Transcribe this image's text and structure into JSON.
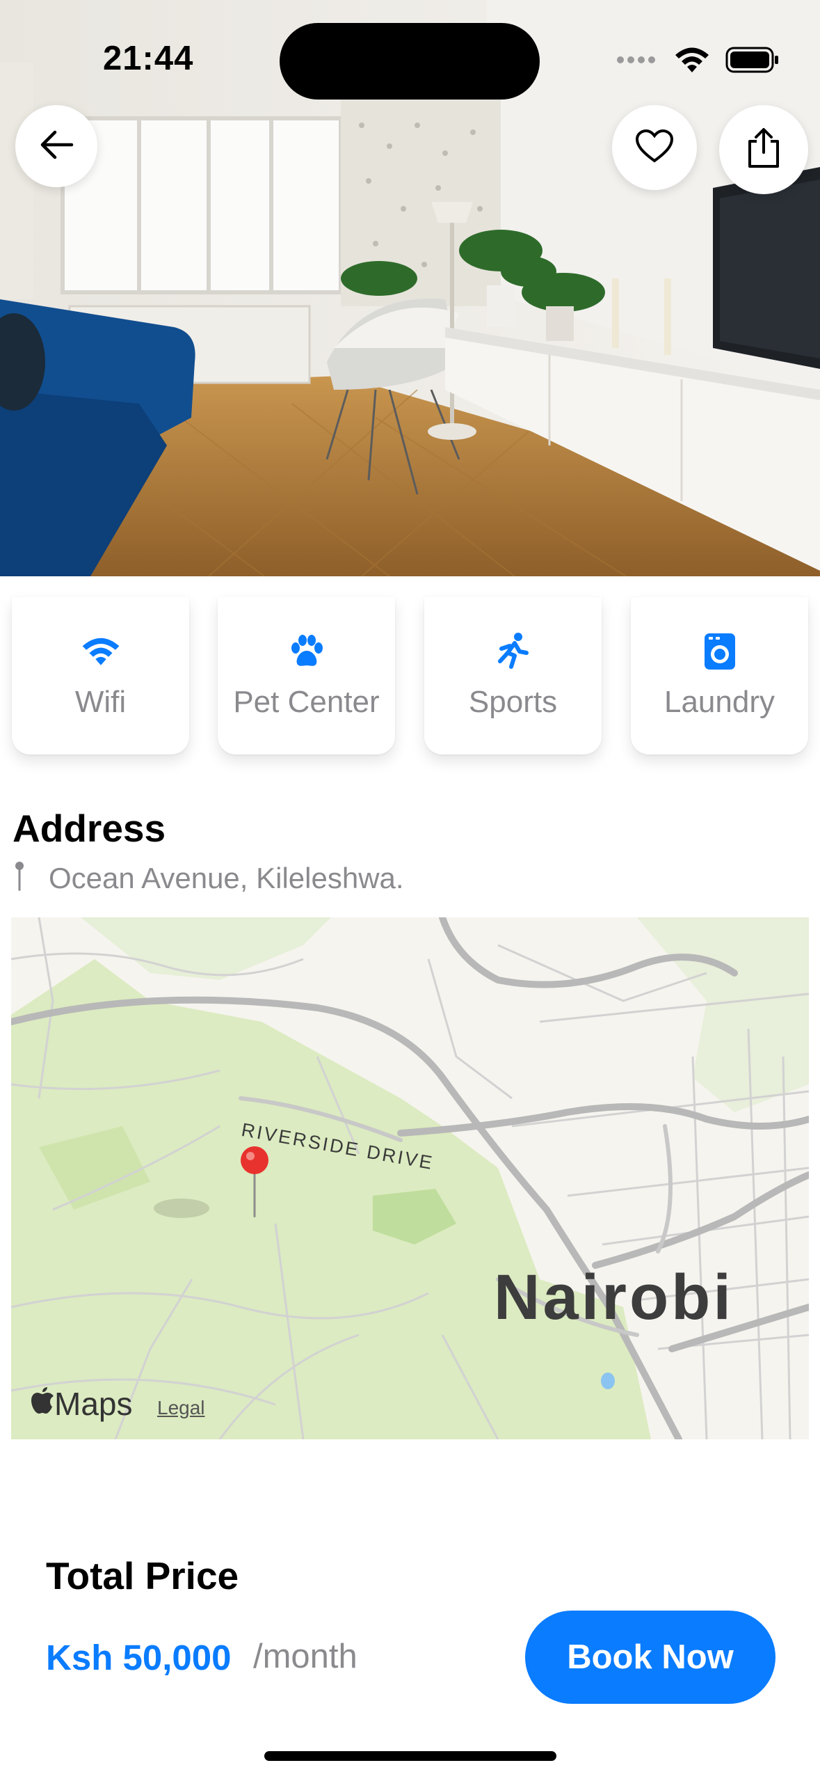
{
  "status_bar": {
    "time": "21:44"
  },
  "header_buttons": {
    "back_icon": "arrow-left-icon",
    "favorite_icon": "heart-icon",
    "share_icon": "share-icon"
  },
  "amenities": [
    {
      "label": "Wifi",
      "icon": "wifi-icon"
    },
    {
      "label": "Pet Center",
      "icon": "paw-icon"
    },
    {
      "label": "Sports",
      "icon": "running-icon"
    },
    {
      "label": "Laundry",
      "icon": "washing-machine-icon"
    }
  ],
  "address": {
    "title": "Address",
    "text": "Ocean Avenue, Kileleshwa."
  },
  "map": {
    "city_label": "Nairobi",
    "street_label": "RIVERSIDE DRIVE",
    "brand": "Maps",
    "legal": "Legal"
  },
  "footer": {
    "total_title": "Total Price",
    "price": "Ksh 50,000",
    "period": "/month",
    "book_label": "Book Now"
  },
  "colors": {
    "accent": "#0a7cff",
    "secondary_text": "#8a8a8e"
  }
}
